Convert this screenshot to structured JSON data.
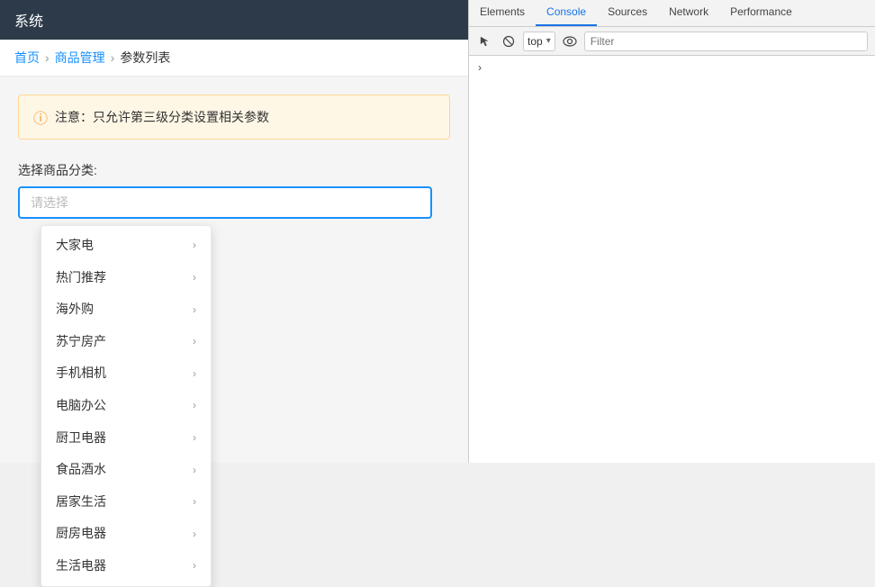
{
  "app": {
    "header": {
      "title": "系统"
    },
    "breadcrumb": {
      "items": [
        {
          "label": "首页",
          "active": false
        },
        {
          "label": "商品管理",
          "active": false
        },
        {
          "label": "参数列表",
          "active": true
        }
      ]
    },
    "warning": {
      "text": "注意：只允许第三级分类设置相关参数"
    },
    "select": {
      "label": "选择商品分类:",
      "placeholder": "请选择"
    },
    "dropdown": {
      "items": [
        {
          "label": "大家电"
        },
        {
          "label": "热门推荐"
        },
        {
          "label": "海外购"
        },
        {
          "label": "苏宁房产"
        },
        {
          "label": "手机相机"
        },
        {
          "label": "电脑办公"
        },
        {
          "label": "厨卫电器"
        },
        {
          "label": "食品酒水"
        },
        {
          "label": "居家生活"
        },
        {
          "label": "厨房电器"
        },
        {
          "label": "生活电器"
        }
      ]
    }
  },
  "devtools": {
    "tabs": [
      {
        "label": "Elements"
      },
      {
        "label": "Console",
        "active": true
      },
      {
        "label": "Sources"
      },
      {
        "label": "Network"
      },
      {
        "label": "Performance"
      }
    ],
    "toolbar": {
      "context": "top",
      "filter_placeholder": "Filter"
    },
    "icons": {
      "cursor": "⬆",
      "block": "🚫",
      "chevron_down": "▾",
      "eye": "👁"
    }
  }
}
